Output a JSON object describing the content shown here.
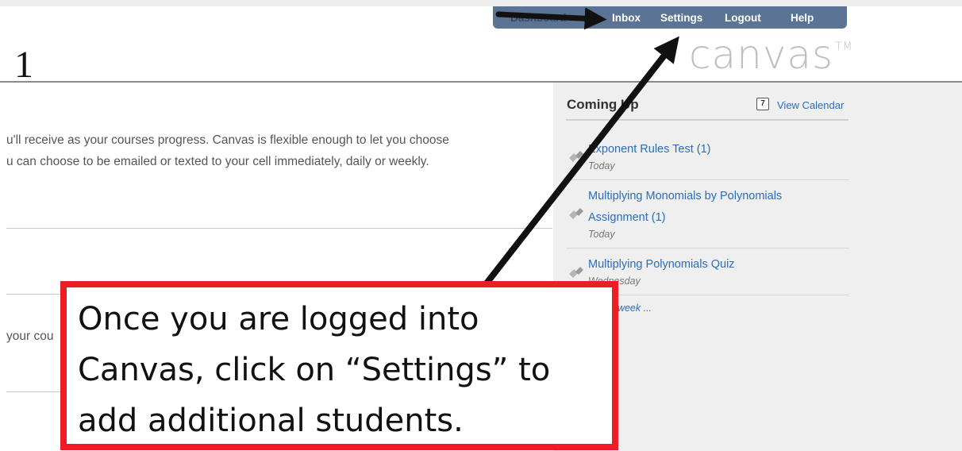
{
  "slide": {
    "number": "1"
  },
  "nav": {
    "faded_link": "Dashboard",
    "links": [
      "Inbox",
      "Settings",
      "Logout",
      "Help"
    ]
  },
  "logo": {
    "text": "canvas",
    "mark": "TM"
  },
  "main": {
    "lines": [
      "u'll receive as your courses progress. Canvas is flexible enough to let you choose",
      "u can choose to be emailed or texted to your cell immediately, daily or weekly.",
      "your cou"
    ]
  },
  "coming_up": {
    "header": "Coming Up",
    "view_calendar": "View Calendar",
    "calendar_icon_glyph": "7",
    "items": [
      {
        "title": "Exponent Rules Test (1)",
        "date": "Today"
      },
      {
        "title_line1": "Multiplying Monomials by Polynomials",
        "title_line2": "Assignment (1)",
        "date": "Today"
      },
      {
        "title": "Multiplying Polynomials Quiz",
        "date": "Wednesday"
      }
    ],
    "past_week": "the past week ..."
  },
  "callout": {
    "lines": [
      "Once you are logged into",
      "Canvas, click on “Settings” to",
      "add additional students."
    ]
  },
  "colors": {
    "navbar": "#5b7394",
    "link": "#2a6ebb",
    "callout_border": "#ee1c24",
    "arrow": "#111111"
  },
  "icons": [
    "calendar-icon",
    "assignment-icon",
    "arrow-icon"
  ]
}
